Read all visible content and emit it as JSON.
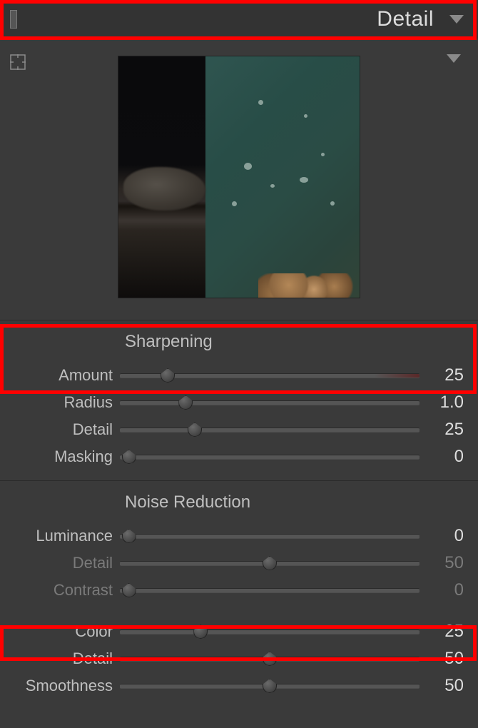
{
  "panel": {
    "title": "Detail"
  },
  "sections": {
    "sharpening": {
      "title": "Sharpening",
      "amount": {
        "label": "Amount",
        "value": "25",
        "pos": 16
      },
      "radius": {
        "label": "Radius",
        "value": "1.0",
        "pos": 22
      },
      "detail": {
        "label": "Detail",
        "value": "25",
        "pos": 25
      },
      "masking": {
        "label": "Masking",
        "value": "0",
        "pos": 3
      }
    },
    "noise": {
      "title": "Noise Reduction",
      "luminance": {
        "label": "Luminance",
        "value": "0",
        "pos": 3
      },
      "lum_detail": {
        "label": "Detail",
        "value": "50",
        "pos": 50
      },
      "lum_contrast": {
        "label": "Contrast",
        "value": "0",
        "pos": 3
      },
      "color": {
        "label": "Color",
        "value": "25",
        "pos": 27
      },
      "col_detail": {
        "label": "Detail",
        "value": "50",
        "pos": 50
      },
      "col_smoothness": {
        "label": "Smoothness",
        "value": "50",
        "pos": 50
      }
    }
  },
  "icons": {
    "target": "target-icon",
    "collapse": "triangle-down-icon"
  }
}
